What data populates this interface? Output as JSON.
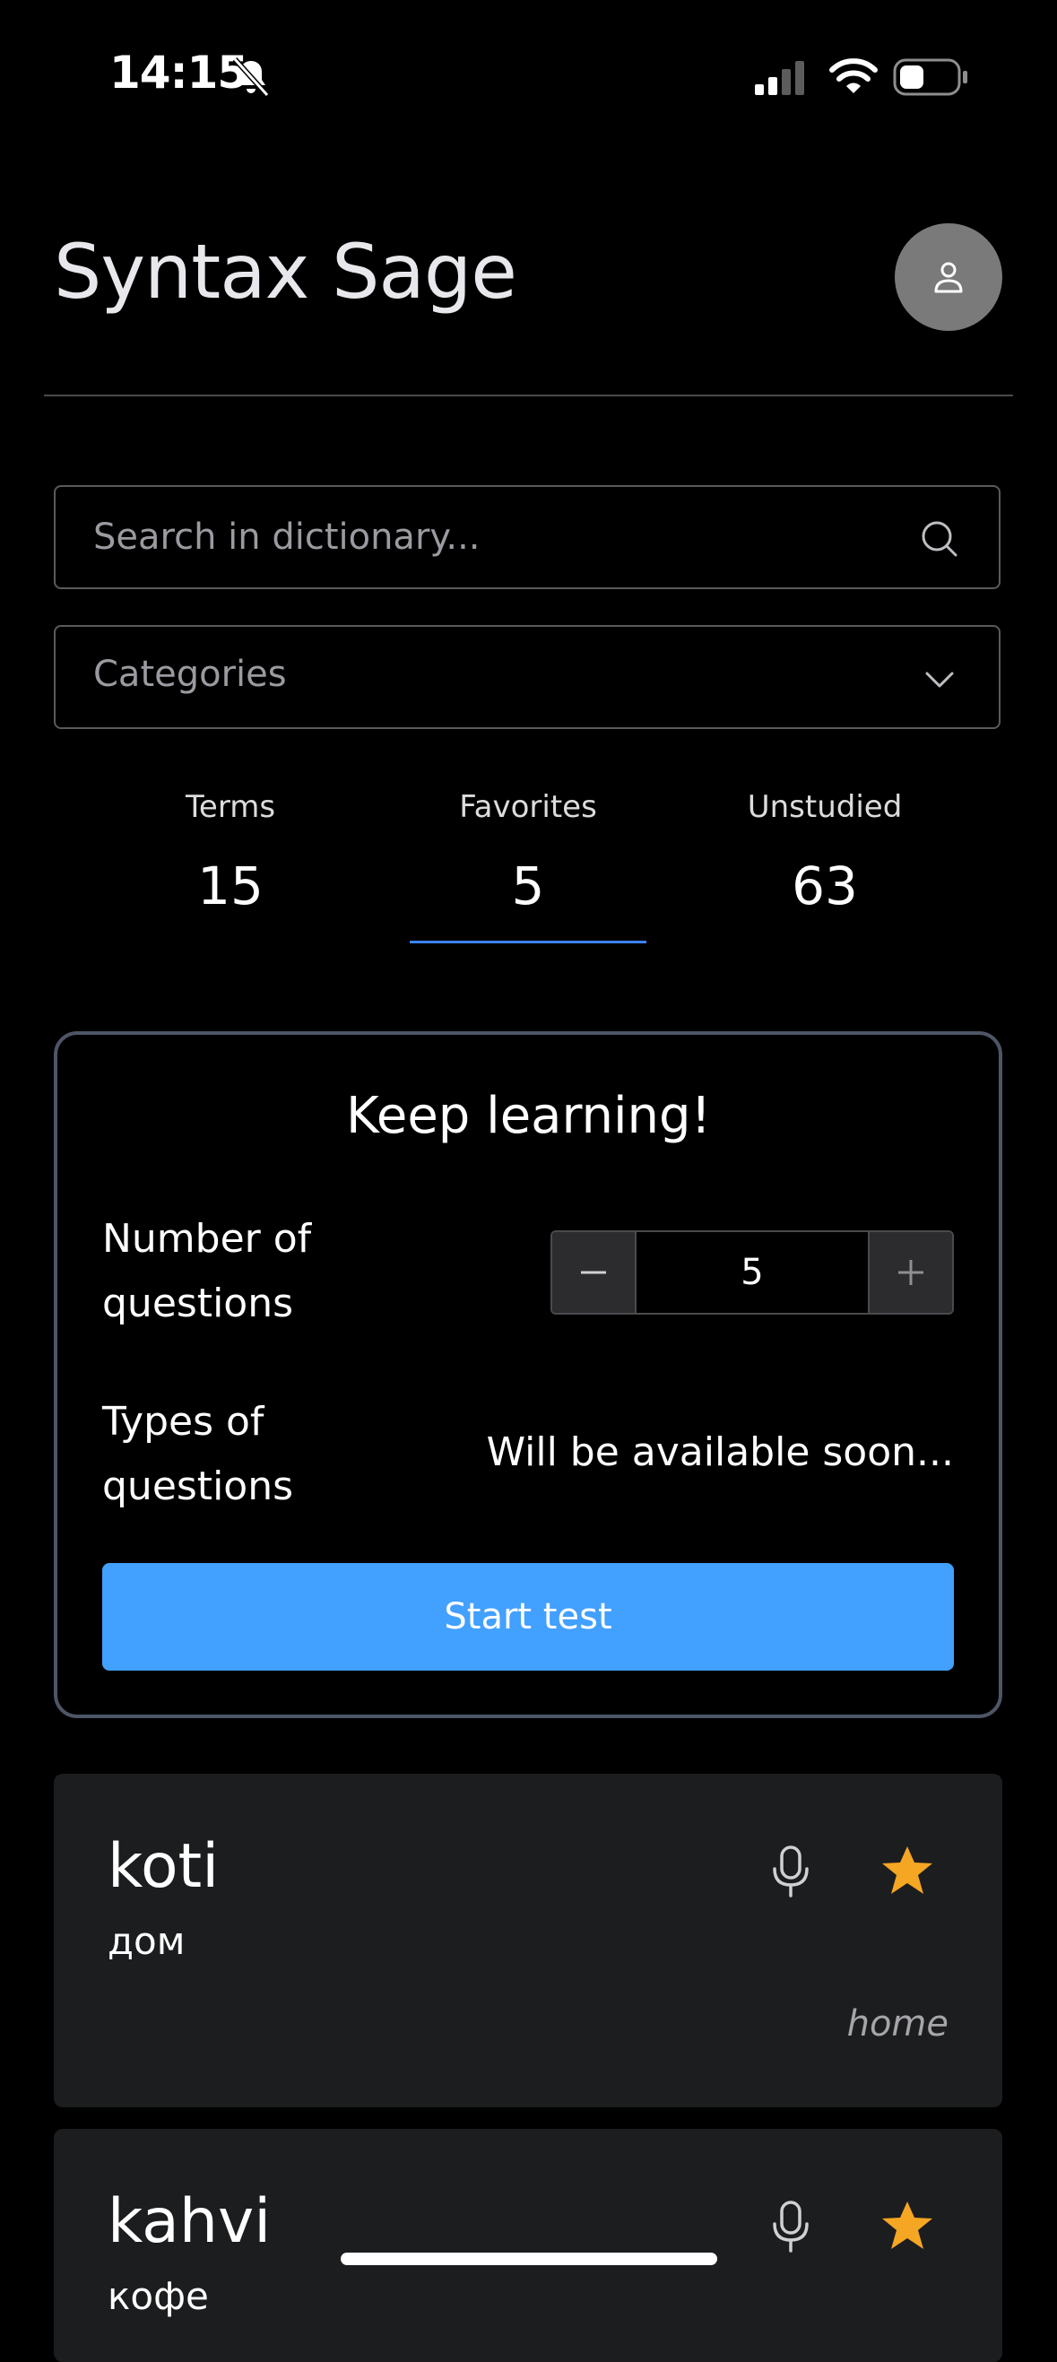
{
  "status_bar": {
    "time": "14:15",
    "icons": [
      "bell-slash-icon",
      "cellular-signal-icon",
      "wifi-icon",
      "battery-icon"
    ]
  },
  "header": {
    "title": "Syntax Sage",
    "avatar_icon": "user-icon"
  },
  "search": {
    "placeholder": "Search in dictionary...",
    "icon": "search-icon"
  },
  "categories": {
    "label": "Categories",
    "icon": "chevron-down-icon"
  },
  "stats": [
    {
      "label": "Terms",
      "value": "15"
    },
    {
      "label": "Favorites",
      "value": "5",
      "selected": true
    },
    {
      "label": "Unstudied",
      "value": "63"
    }
  ],
  "quiz": {
    "title": "Keep learning!",
    "questions_label": "Number of questions",
    "questions_value": "5",
    "types_label": "Types of questions",
    "types_value": "Will be available soon...",
    "start_label": "Start test"
  },
  "words": [
    {
      "term": "koti",
      "translation": "дом",
      "english": "home",
      "favorite": true
    },
    {
      "term": "kahvi",
      "translation": "кофе",
      "favorite": true
    }
  ],
  "colors": {
    "accent": "#42a0ff",
    "underline": "#3b82f6",
    "star": "#f5a623",
    "card_bg": "#1c1d1f",
    "page_bg": "#000000"
  }
}
